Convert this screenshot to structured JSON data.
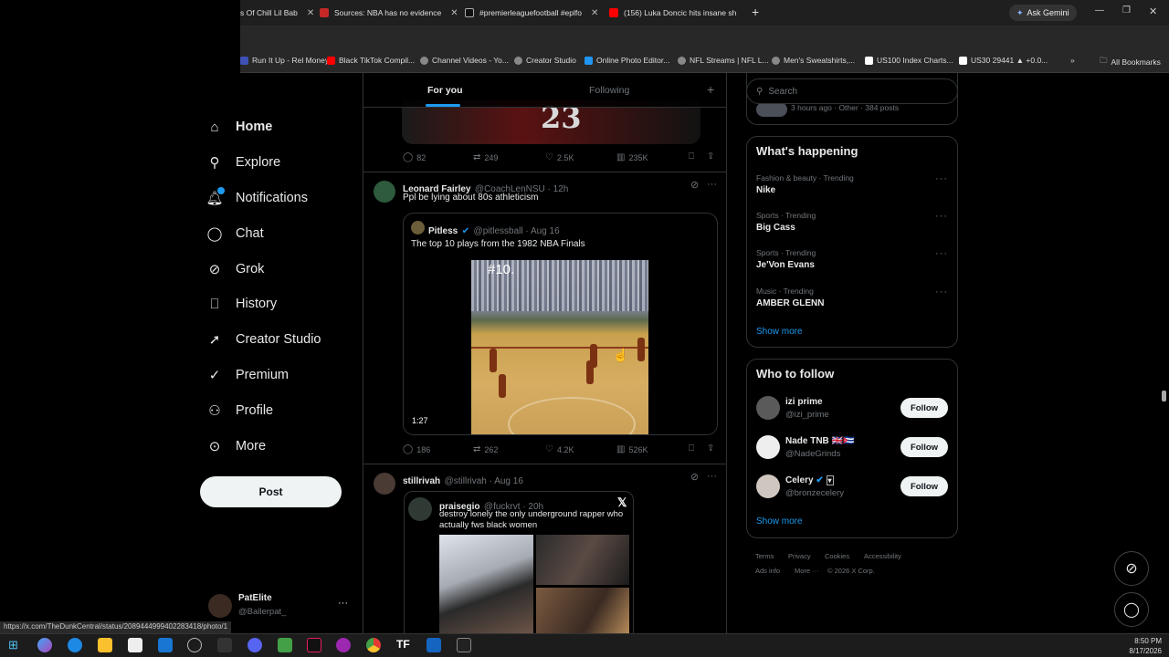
{
  "browser": {
    "tabs": [
      {
        "label": "s Of Chill Lil Bab",
        "color": "#444"
      },
      {
        "label": "Sources: NBA has no evidence",
        "color": "#c62828"
      },
      {
        "label": "#premierleaguefootball #eplfo",
        "color": "#111"
      },
      {
        "label": "(156) Luka Doncic hits insane sh",
        "color": "#ff0000"
      }
    ],
    "new_tab": "+",
    "ask_gemini": "Ask Gemini",
    "bookmarks": [
      "Run It Up - Rel Money",
      "Black TikTok Compil...",
      "Channel Videos - Yo...",
      "Creator Studio",
      "Online Photo Editor...",
      "NFL Streams | NFL L...",
      "Men's Sweatshirts,...",
      "US100 Index Charts...",
      "US30 29441 ▲ +0.0..."
    ],
    "all_bookmarks": "All Bookmarks",
    "status_url": "https://x.com/TheDunkCentral/status/2089444999402283418/photo/1"
  },
  "nav": {
    "items": [
      "Home",
      "Explore",
      "Notifications",
      "Chat",
      "Grok",
      "History",
      "Creator Studio",
      "Premium",
      "Profile",
      "More"
    ],
    "post": "Post",
    "account_name": "PatElite",
    "account_handle": "@Ballerpat_"
  },
  "feed": {
    "tabs": {
      "for_you": "For you",
      "following": "Following"
    },
    "top_post": {
      "jersey": "23",
      "replies": "82",
      "reposts": "249",
      "likes": "2.5K",
      "views": "235K"
    },
    "post1": {
      "name": "Leonard Fairley",
      "handle": "@CoachLenNSU · 12h",
      "text": "Ppl be lying about 80s athleticism",
      "quote_name": "Pitless",
      "quote_handle": "@pitlessball · Aug 16",
      "quote_text": "The top 10 plays from the 1982 NBA Finals",
      "video_label": "#10.",
      "duration": "1:27",
      "replies": "186",
      "reposts": "262",
      "likes": "4.2K",
      "views": "526K"
    },
    "post2": {
      "name": "stillrivah",
      "handle": "@stillrivah · Aug 16",
      "inner_name": "praisegio",
      "inner_handle": "@fuckrvt · 20h",
      "inner_text_1": "destroy lonely the only underground rapper who",
      "inner_text_2": "actually fws black women"
    }
  },
  "right": {
    "search_placeholder": "Search",
    "top_meta": "3 hours ago · Other · 384 posts",
    "whats_happening": "What's happening",
    "trends": [
      {
        "meta": "Fashion & beauty · Trending",
        "name": "Nike"
      },
      {
        "meta": "Sports · Trending",
        "name": "Big Cass"
      },
      {
        "meta": "Sports · Trending",
        "name": "Je'Von Evans"
      },
      {
        "meta": "Music · Trending",
        "name": "AMBER GLENN"
      }
    ],
    "show_more": "Show more",
    "who_to_follow": "Who to follow",
    "follow_label": "Follow",
    "suggestions": [
      {
        "name": "izi prime",
        "handle": "@izi_prime"
      },
      {
        "name": "Nade TNB 🇬🇧🇨🇺",
        "handle": "@NadeGrinds"
      },
      {
        "name": "Celery",
        "handle": "@bronzecelery"
      }
    ],
    "footer": [
      "Terms",
      "Privacy",
      "Cookies",
      "Accessibility",
      "Ads info",
      "More ···",
      "© 2026 X Corp."
    ]
  },
  "taskbar": {
    "time": "8:50 PM",
    "date": "8/17/2026"
  }
}
